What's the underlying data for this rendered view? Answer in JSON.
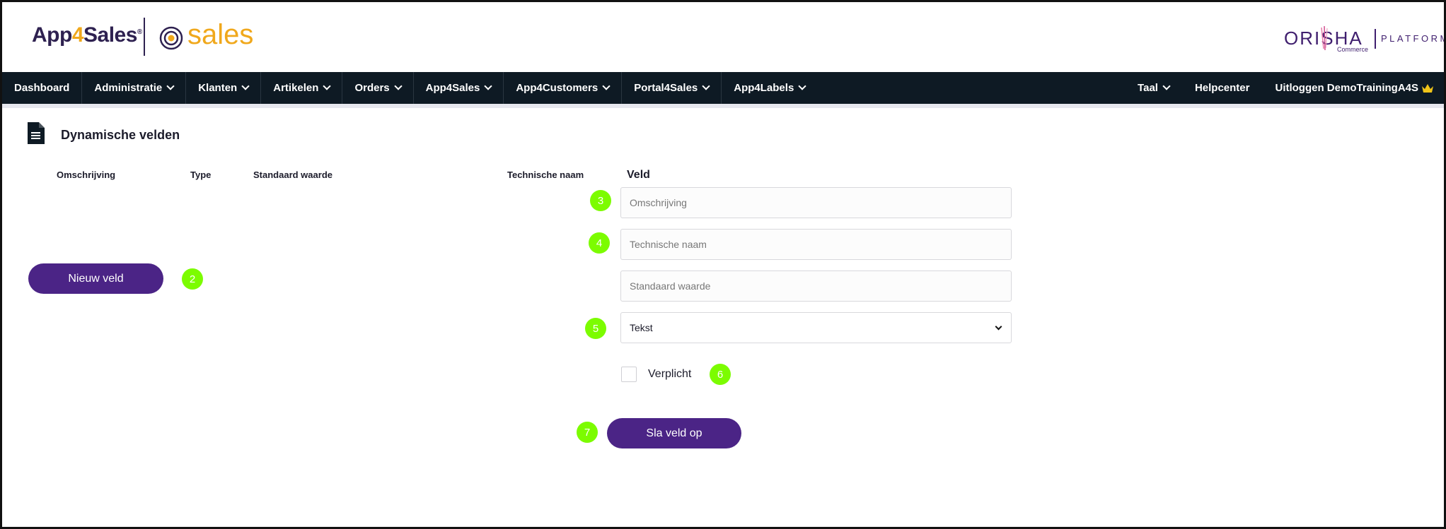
{
  "header": {
    "logo_text_a": "App",
    "logo_text_four": "4",
    "logo_text_b": "Sales",
    "logo_reg": "®",
    "sales_logo_text": "sales",
    "partner_name": "ORISHA",
    "partner_sub": "Commerce",
    "partner_platform": "PLATFORM"
  },
  "nav": {
    "left": [
      {
        "label": "Dashboard",
        "dropdown": false
      },
      {
        "label": "Administratie",
        "dropdown": true
      },
      {
        "label": "Klanten",
        "dropdown": true
      },
      {
        "label": "Artikelen",
        "dropdown": true
      },
      {
        "label": "Orders",
        "dropdown": true
      },
      {
        "label": "App4Sales",
        "dropdown": true
      },
      {
        "label": "App4Customers",
        "dropdown": true
      },
      {
        "label": "Portal4Sales",
        "dropdown": true
      },
      {
        "label": "App4Labels",
        "dropdown": true
      }
    ],
    "right": {
      "language": "Taal",
      "help": "Helpcenter",
      "logout": "Uitloggen DemoTrainingA4S"
    }
  },
  "page": {
    "title": "Dynamische velden"
  },
  "table": {
    "columns": [
      "Omschrijving",
      "Type",
      "Standaard waarde",
      "Technische naam"
    ]
  },
  "form": {
    "title": "Veld",
    "description_placeholder": "Omschrijving",
    "technical_name_placeholder": "Technische naam",
    "default_value_placeholder": "Standaard waarde",
    "type_selected": "Tekst",
    "required_label": "Verplicht",
    "save_label": "Sla veld op"
  },
  "actions": {
    "new_field_label": "Nieuw veld"
  },
  "markers": [
    "2",
    "3",
    "4",
    "5",
    "6",
    "7"
  ],
  "colors": {
    "nav_bg": "#0e1a24",
    "primary": "#4b2486",
    "accent": "#f0a81c",
    "marker": "#7cfc00"
  }
}
